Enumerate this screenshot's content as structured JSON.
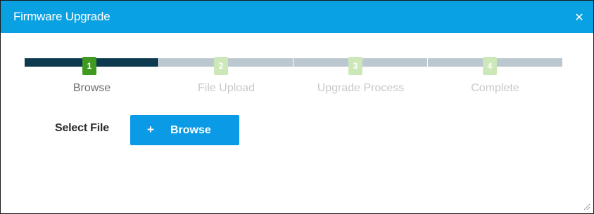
{
  "dialog": {
    "title": "Firmware Upgrade",
    "close_icon": "close-icon",
    "header_color": "#0aa1e2"
  },
  "stepper": {
    "active_step": 1,
    "steps": [
      {
        "number": "1",
        "label": "Browse",
        "state": "active"
      },
      {
        "number": "2",
        "label": "File Upload",
        "state": "pending"
      },
      {
        "number": "3",
        "label": "Upgrade Process",
        "state": "pending"
      },
      {
        "number": "4",
        "label": "Complete",
        "state": "pending"
      }
    ],
    "active_bar_color": "#0e3a4f",
    "inactive_bar_color": "#bcc8cf",
    "active_badge_color": "#3f9a1f",
    "inactive_badge_color": "#cde8b8"
  },
  "form": {
    "select_file_label": "Select File",
    "browse_button_label": "Browse",
    "browse_icon": "plus-icon",
    "button_color": "#0b9ae6"
  },
  "resize_icon": "resize-grip-icon"
}
